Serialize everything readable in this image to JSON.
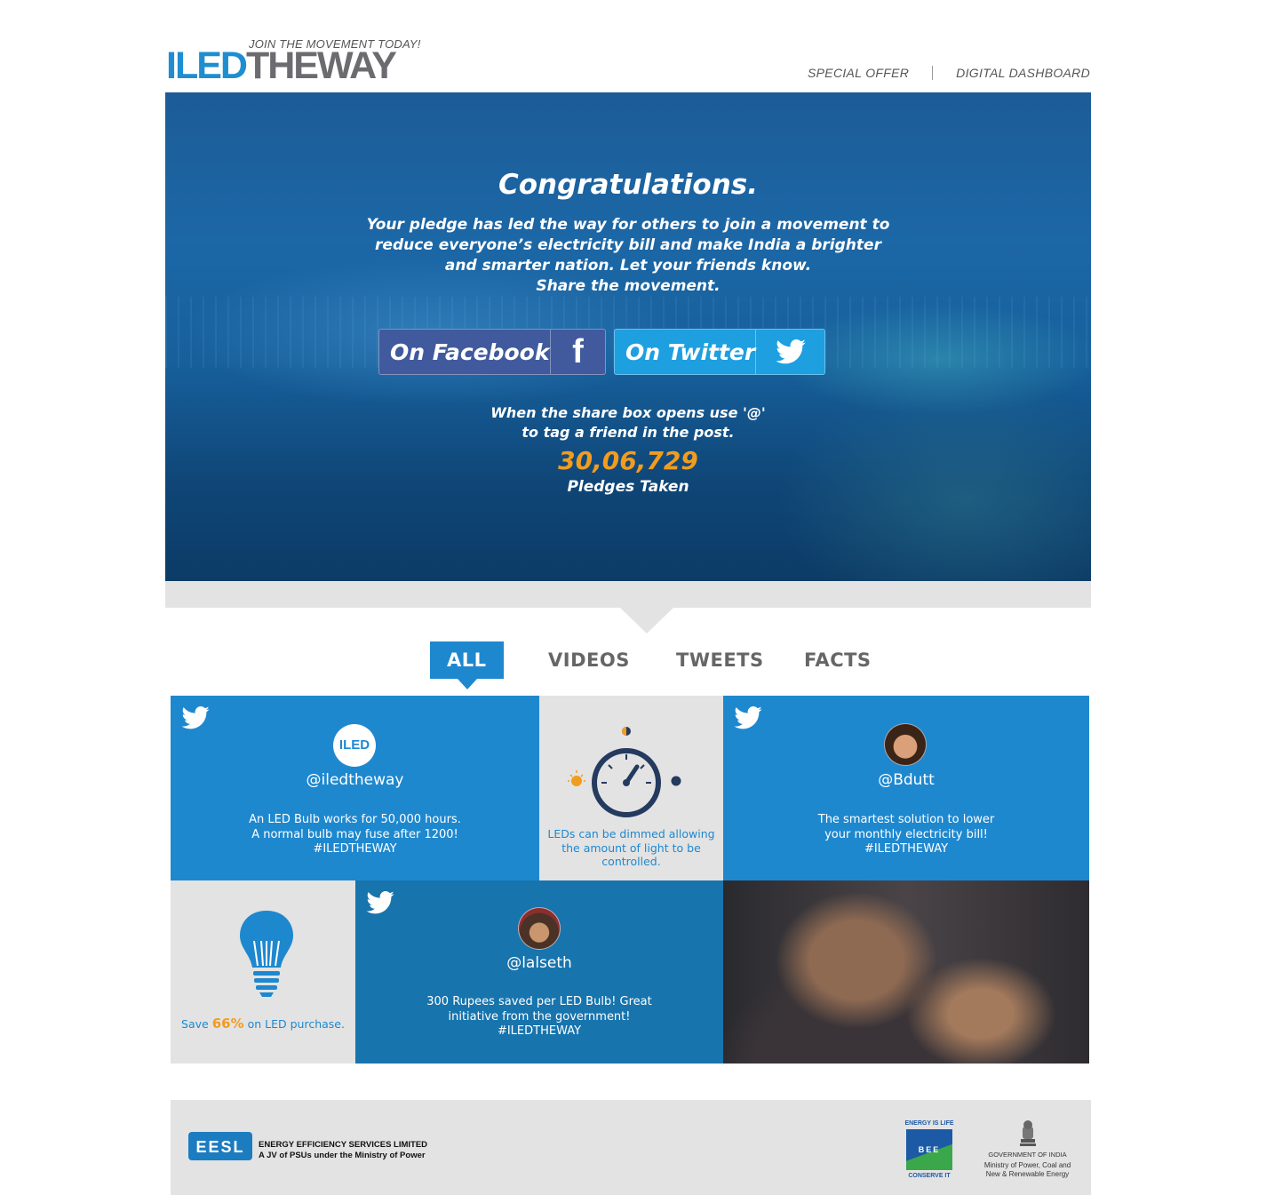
{
  "header": {
    "tagline": "JOIN THE MOVEMENT TODAY!",
    "logo_part1": "ILED",
    "logo_part2": "THEWAY",
    "nav": [
      "SPECIAL OFFER",
      "DIGITAL DASHBOARD"
    ]
  },
  "hero": {
    "title": "Congratulations.",
    "lines": [
      "Your pledge has led the way for others to join a movement to",
      "reduce everyone’s electricity bill and make India a brighter",
      "and smarter nation. Let your friends know.",
      "Share the movement."
    ],
    "facebook_label": "On Facebook",
    "twitter_label": "On Twitter",
    "hint_lines": [
      "When the share box opens use '@'",
      "to tag a friend in the post."
    ],
    "pledge_count": "30,06,729",
    "pledge_label": "Pledges Taken"
  },
  "tabs": [
    "ALL",
    "VIDEOS",
    "TWEETS",
    "FACTS"
  ],
  "active_tab": "ALL",
  "tiles": {
    "iledtheway": {
      "avatar_text": "ILED",
      "handle": "@iledtheway",
      "lines": [
        "An LED Bulb works for 50,000 hours.",
        "A normal bulb may fuse after 1200!",
        "#ILEDTHEWAY"
      ]
    },
    "dimmer_fact": {
      "lines": [
        "LEDs can be dimmed allowing",
        "the amount of light to be",
        "controlled."
      ]
    },
    "bdutt": {
      "handle": "@Bdutt",
      "lines": [
        "The smartest solution to lower",
        "your monthly electricity bill!",
        "#ILEDTHEWAY"
      ]
    },
    "save_fact": {
      "prefix": "Save",
      "percent": "66%",
      "suffix": "on LED purchase."
    },
    "lalseth": {
      "handle": "@lalseth",
      "lines": [
        "300 Rupees saved per LED Bulb! Great",
        "initiative from the government!",
        "#ILEDTHEWAY"
      ]
    }
  },
  "footer": {
    "eesl_logo": "EESL",
    "eesl_title": "ENERGY EFFICIENCY SERVICES LIMITED",
    "eesl_subtitle": "A JV of PSUs under the Ministry of Power",
    "bee_top": "ENERGY IS LIFE",
    "bee_mid": "BEE",
    "bee_bottom": "CONSERVE IT",
    "gov_title": "GOVERNMENT OF INDIA",
    "gov_ministry_1": "Ministry of Power, Coal and",
    "gov_ministry_2": "New & Renewable Energy"
  },
  "colors": {
    "brand_blue": "#1e88cf",
    "facebook": "#405a9d",
    "twitter": "#1e9fe0",
    "accent_orange": "#f29c1f",
    "tile_grey": "#e3e3e3",
    "icon_navy": "#243a5e"
  }
}
